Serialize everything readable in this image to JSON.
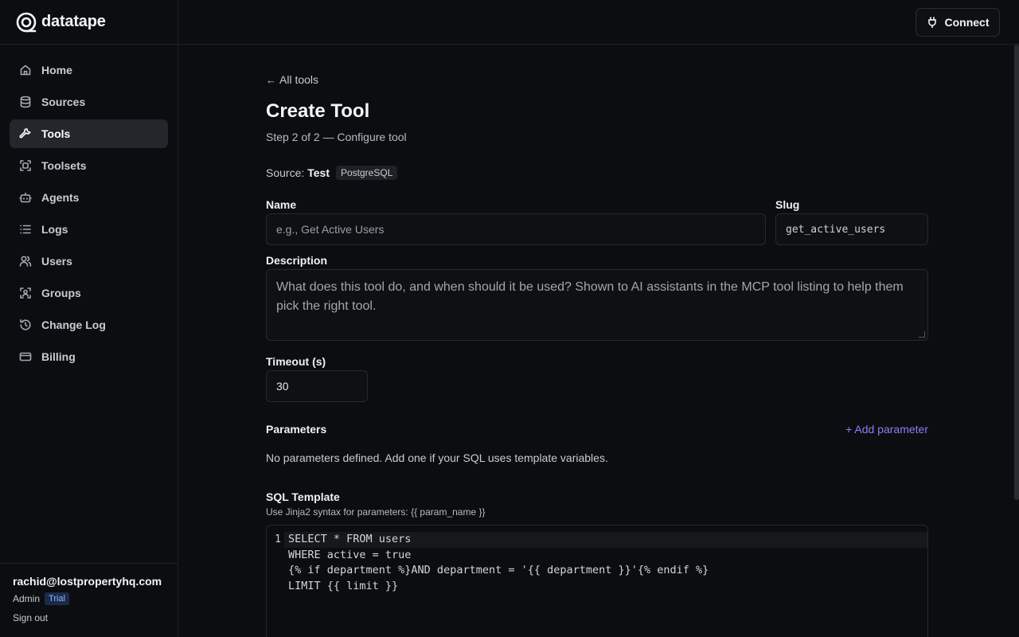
{
  "brand": {
    "name": "datatape"
  },
  "sidebar": {
    "items": [
      {
        "label": "Home",
        "icon": "home-icon"
      },
      {
        "label": "Sources",
        "icon": "database-icon"
      },
      {
        "label": "Tools",
        "icon": "wrench-icon",
        "active": true
      },
      {
        "label": "Toolsets",
        "icon": "scan-icon"
      },
      {
        "label": "Agents",
        "icon": "bot-icon"
      },
      {
        "label": "Logs",
        "icon": "list-icon"
      },
      {
        "label": "Users",
        "icon": "users-icon"
      },
      {
        "label": "Groups",
        "icon": "user-scan-icon"
      },
      {
        "label": "Change Log",
        "icon": "history-icon"
      },
      {
        "label": "Billing",
        "icon": "credit-card-icon"
      }
    ],
    "user": {
      "email": "rachid@lostpropertyhq.com",
      "role": "Admin",
      "plan_badge": "Trial",
      "signout_label": "Sign out"
    }
  },
  "topbar": {
    "connect_label": "Connect"
  },
  "main": {
    "back_label": "All tools",
    "title": "Create Tool",
    "subtitle": "Step 2 of 2 — Configure tool",
    "source": {
      "prefix": "Source:",
      "name": "Test",
      "type": "PostgreSQL"
    },
    "name_field": {
      "label": "Name",
      "placeholder": "e.g., Get Active Users",
      "value": ""
    },
    "slug_field": {
      "label": "Slug",
      "placeholder": "get_active_users",
      "value": ""
    },
    "description_field": {
      "label": "Description",
      "placeholder": "What does this tool do, and when should it be used? Shown to AI assistants in the MCP tool listing to help them pick the right tool.",
      "value": ""
    },
    "timeout_field": {
      "label": "Timeout (s)",
      "value": "30"
    },
    "parameters": {
      "title": "Parameters",
      "add_label": "+ Add parameter",
      "empty_text": "No parameters defined. Add one if your SQL uses template variables."
    },
    "sql": {
      "title": "SQL Template",
      "hint": "Use Jinja2 syntax for parameters: {{ param_name }}",
      "line_number": "1",
      "lines": [
        "SELECT * FROM users",
        "WHERE active = true",
        "{% if department %}AND department = '{{ department }}'{% endif %}",
        "LIMIT {{ limit }}"
      ]
    }
  },
  "colors": {
    "accent": "#8b7cf6",
    "active_nav_bg": "#24262c",
    "trial_badge": "#8fb4ff"
  }
}
